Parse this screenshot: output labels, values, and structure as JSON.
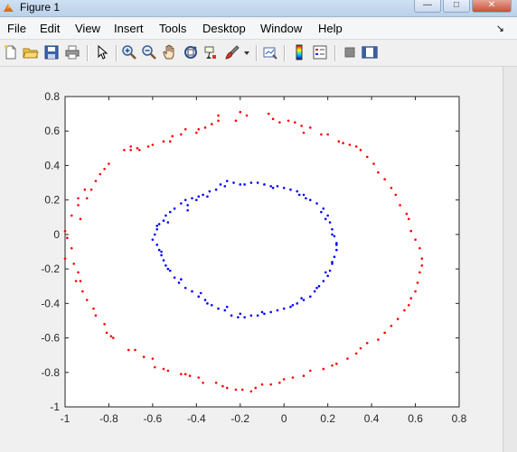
{
  "window": {
    "title": "Figure 1",
    "minimize_glyph": "—",
    "maximize_glyph": "□",
    "close_glyph": "✕"
  },
  "menu": {
    "items": [
      "File",
      "Edit",
      "View",
      "Insert",
      "Tools",
      "Desktop",
      "Window",
      "Help"
    ],
    "dock_glyph": "↘"
  },
  "toolbar": {
    "icons": [
      "new-figure-icon",
      "open-file-icon",
      "save-icon",
      "print-icon",
      "select-arrow-icon",
      "zoom-in-icon",
      "zoom-out-icon",
      "pan-hand-icon",
      "rotate-3d-icon",
      "data-cursor-icon",
      "brush-icon",
      "brush-dropdown-icon",
      "link-plot-icon",
      "insert-colorbar-icon",
      "insert-legend-icon",
      "hide-plot-tools-icon",
      "show-plot-tools-icon"
    ]
  },
  "colors": {
    "outer_series": "#ff0000",
    "inner_series": "#0000ff",
    "axes_background": "#ffffff",
    "figure_background": "#f0f0f0"
  },
  "chart_data": {
    "type": "scatter",
    "xlim": [
      -1,
      0.8
    ],
    "ylim": [
      -1,
      0.8
    ],
    "xticks": [
      -1,
      -0.8,
      -0.6,
      -0.4,
      -0.2,
      0,
      0.2,
      0.4,
      0.6,
      0.8
    ],
    "yticks": [
      0.8,
      0.6,
      0.4,
      0.2,
      0,
      -0.2,
      -0.4,
      -0.6,
      -0.8,
      -1
    ],
    "xtick_labels": [
      "-1",
      "-0.8",
      "-0.6",
      "-0.4",
      "-0.2",
      "0",
      "0.2",
      "0.4",
      "0.6",
      "0.8"
    ],
    "ytick_labels": [
      "0.8",
      "0.6",
      "0.4",
      "0.2",
      "0",
      "-0.2",
      "-0.4",
      "-0.6",
      "-0.8",
      "-1"
    ],
    "grid": false,
    "series": [
      {
        "color": "#ff0000",
        "marker": "point",
        "points": [
          [
            -0.2,
            0.71
          ],
          [
            -0.17,
            0.69
          ],
          [
            -0.07,
            0.7
          ],
          [
            -0.05,
            0.67
          ],
          [
            -0.3,
            0.66
          ],
          [
            -0.3,
            0.69
          ],
          [
            -0.33,
            0.64
          ],
          [
            -0.36,
            0.62
          ],
          [
            -0.39,
            0.61
          ],
          [
            -0.45,
            0.61
          ],
          [
            -0.47,
            0.58
          ],
          [
            -0.51,
            0.57
          ],
          [
            -0.52,
            0.54
          ],
          [
            -0.55,
            0.54
          ],
          [
            -0.62,
            0.51
          ],
          [
            -0.66,
            0.49
          ],
          [
            -0.7,
            0.49
          ],
          [
            -0.7,
            0.51
          ],
          [
            -0.73,
            0.49
          ],
          [
            -0.8,
            0.41
          ],
          [
            -0.82,
            0.38
          ],
          [
            -0.84,
            0.35
          ],
          [
            -0.86,
            0.31
          ],
          [
            -0.88,
            0.26
          ],
          [
            -0.91,
            0.26
          ],
          [
            -0.94,
            0.21
          ],
          [
            -0.9,
            0.21
          ],
          [
            -0.94,
            0.17
          ],
          [
            -0.97,
            0.11
          ],
          [
            -0.93,
            0.09
          ],
          [
            -1.0,
            0.02
          ],
          [
            -0.99,
            -0.02
          ],
          [
            -0.97,
            -0.08
          ],
          [
            -1.0,
            -0.14
          ],
          [
            -0.96,
            -0.17
          ],
          [
            -0.94,
            -0.22
          ],
          [
            -0.95,
            -0.27
          ],
          [
            -0.93,
            -0.27
          ],
          [
            -0.92,
            -0.33
          ],
          [
            -0.9,
            -0.38
          ],
          [
            -0.87,
            -0.43
          ],
          [
            -0.86,
            -0.47
          ],
          [
            -0.82,
            -0.52
          ],
          [
            -0.81,
            -0.57
          ],
          [
            -0.79,
            -0.59
          ],
          [
            -0.78,
            -0.6
          ],
          [
            -0.71,
            -0.67
          ],
          [
            -0.68,
            -0.67
          ],
          [
            -0.64,
            -0.71
          ],
          [
            -0.6,
            -0.72
          ],
          [
            -0.59,
            -0.77
          ],
          [
            -0.55,
            -0.78
          ],
          [
            -0.53,
            -0.79
          ],
          [
            -0.47,
            -0.81
          ],
          [
            -0.45,
            -0.81
          ],
          [
            -0.43,
            -0.82
          ],
          [
            -0.39,
            -0.83
          ],
          [
            -0.37,
            -0.86
          ],
          [
            -0.31,
            -0.86
          ],
          [
            -0.28,
            -0.88
          ],
          [
            -0.26,
            -0.89
          ],
          [
            -0.22,
            -0.9
          ],
          [
            -0.19,
            -0.9
          ],
          [
            -0.15,
            -0.91
          ],
          [
            -0.13,
            -0.89
          ],
          [
            -0.1,
            -0.87
          ],
          [
            -0.06,
            -0.87
          ],
          [
            -0.02,
            -0.86
          ],
          [
            0.0,
            -0.84
          ],
          [
            0.04,
            -0.83
          ],
          [
            0.09,
            -0.82
          ],
          [
            0.12,
            -0.79
          ],
          [
            0.18,
            -0.78
          ],
          [
            0.22,
            -0.76
          ],
          [
            0.24,
            -0.75
          ],
          [
            0.29,
            -0.72
          ],
          [
            0.33,
            -0.69
          ],
          [
            0.35,
            -0.66
          ],
          [
            0.38,
            -0.63
          ],
          [
            0.43,
            -0.61
          ],
          [
            0.46,
            -0.57
          ],
          [
            0.49,
            -0.53
          ],
          [
            0.52,
            -0.49
          ],
          [
            0.55,
            -0.44
          ],
          [
            0.57,
            -0.41
          ],
          [
            0.58,
            -0.37
          ],
          [
            0.6,
            -0.33
          ],
          [
            0.61,
            -0.28
          ],
          [
            0.62,
            -0.22
          ],
          [
            0.63,
            -0.18
          ],
          [
            0.63,
            -0.14
          ],
          [
            0.62,
            -0.08
          ],
          [
            0.6,
            -0.03
          ],
          [
            0.58,
            0.02
          ],
          [
            0.57,
            0.09
          ],
          [
            0.56,
            0.12
          ],
          [
            0.53,
            0.17
          ],
          [
            0.51,
            0.23
          ],
          [
            0.49,
            0.27
          ],
          [
            0.46,
            0.32
          ],
          [
            0.43,
            0.36
          ],
          [
            0.41,
            0.41
          ],
          [
            0.38,
            0.45
          ],
          [
            0.35,
            0.49
          ],
          [
            0.33,
            0.51
          ],
          [
            0.3,
            0.52
          ],
          [
            0.27,
            0.53
          ],
          [
            0.25,
            0.54
          ],
          [
            0.2,
            0.58
          ],
          [
            0.17,
            0.58
          ],
          [
            0.12,
            0.62
          ],
          [
            0.08,
            0.63
          ],
          [
            0.05,
            0.65
          ],
          [
            0.02,
            0.66
          ],
          [
            -0.02,
            0.65
          ],
          [
            0.09,
            0.59
          ],
          [
            -0.22,
            0.66
          ],
          [
            -0.4,
            0.59
          ],
          [
            -0.6,
            0.52
          ],
          [
            -0.67,
            0.5
          ]
        ]
      },
      {
        "color": "#0000ff",
        "marker": "point",
        "points": [
          [
            -0.2,
            0.29
          ],
          [
            -0.23,
            0.3
          ],
          [
            -0.26,
            0.31
          ],
          [
            -0.29,
            0.29
          ],
          [
            -0.31,
            0.26
          ],
          [
            -0.34,
            0.25
          ],
          [
            -0.37,
            0.23
          ],
          [
            -0.39,
            0.22
          ],
          [
            -0.42,
            0.21
          ],
          [
            -0.45,
            0.2
          ],
          [
            -0.47,
            0.18
          ],
          [
            -0.5,
            0.15
          ],
          [
            -0.52,
            0.13
          ],
          [
            -0.54,
            0.11
          ],
          [
            -0.55,
            0.08
          ],
          [
            -0.57,
            0.06
          ],
          [
            -0.58,
            0.03
          ],
          [
            -0.59,
            0.0
          ],
          [
            -0.6,
            -0.03
          ],
          [
            -0.58,
            -0.06
          ],
          [
            -0.57,
            -0.09
          ],
          [
            -0.56,
            -0.12
          ],
          [
            -0.55,
            -0.15
          ],
          [
            -0.54,
            -0.18
          ],
          [
            -0.52,
            -0.21
          ],
          [
            -0.5,
            -0.25
          ],
          [
            -0.48,
            -0.28
          ],
          [
            -0.45,
            -0.31
          ],
          [
            -0.42,
            -0.33
          ],
          [
            -0.39,
            -0.36
          ],
          [
            -0.36,
            -0.38
          ],
          [
            -0.33,
            -0.41
          ],
          [
            -0.3,
            -0.43
          ],
          [
            -0.27,
            -0.44
          ],
          [
            -0.24,
            -0.47
          ],
          [
            -0.21,
            -0.48
          ],
          [
            -0.18,
            -0.48
          ],
          [
            -0.15,
            -0.47
          ],
          [
            -0.12,
            -0.47
          ],
          [
            -0.09,
            -0.46
          ],
          [
            -0.06,
            -0.45
          ],
          [
            -0.03,
            -0.44
          ],
          [
            0.0,
            -0.43
          ],
          [
            0.03,
            -0.42
          ],
          [
            0.06,
            -0.4
          ],
          [
            0.09,
            -0.38
          ],
          [
            0.12,
            -0.36
          ],
          [
            0.14,
            -0.33
          ],
          [
            0.16,
            -0.3
          ],
          [
            0.18,
            -0.27
          ],
          [
            0.2,
            -0.24
          ],
          [
            0.21,
            -0.21
          ],
          [
            0.22,
            -0.17
          ],
          [
            0.23,
            -0.13
          ],
          [
            0.24,
            -0.09
          ],
          [
            0.24,
            -0.05
          ],
          [
            0.23,
            -0.01
          ],
          [
            0.22,
            0.03
          ],
          [
            0.21,
            0.07
          ],
          [
            0.2,
            0.11
          ],
          [
            0.18,
            0.15
          ],
          [
            0.15,
            0.18
          ],
          [
            0.12,
            0.2
          ],
          [
            0.09,
            0.23
          ],
          [
            0.06,
            0.25
          ],
          [
            0.03,
            0.26
          ],
          [
            0.0,
            0.27
          ],
          [
            -0.03,
            0.28
          ],
          [
            -0.06,
            0.28
          ],
          [
            -0.09,
            0.29
          ],
          [
            -0.12,
            0.3
          ],
          [
            -0.15,
            0.3
          ],
          [
            -0.35,
            0.22
          ],
          [
            -0.44,
            0.17
          ],
          [
            -0.53,
            0.07
          ],
          [
            -0.56,
            -0.1
          ],
          [
            -0.47,
            -0.26
          ],
          [
            -0.35,
            -0.4
          ],
          [
            -0.2,
            -0.46
          ],
          [
            0.04,
            -0.41
          ],
          [
            0.15,
            -0.31
          ],
          [
            0.22,
            -0.16
          ],
          [
            0.22,
            0.0
          ],
          [
            0.17,
            0.13
          ],
          [
            0.07,
            0.23
          ],
          [
            -0.05,
            0.27
          ],
          [
            -0.27,
            0.28
          ],
          [
            -0.4,
            0.2
          ],
          [
            -0.58,
            0.05
          ],
          [
            -0.53,
            -0.2
          ],
          [
            -0.38,
            -0.34
          ],
          [
            -0.26,
            -0.42
          ],
          [
            -0.1,
            -0.45
          ],
          [
            0.08,
            -0.37
          ],
          [
            0.19,
            -0.22
          ],
          [
            0.24,
            -0.06
          ],
          [
            0.19,
            0.09
          ],
          [
            0.1,
            0.21
          ],
          [
            -0.18,
            0.29
          ],
          [
            -0.44,
            0.14
          ]
        ]
      }
    ]
  }
}
